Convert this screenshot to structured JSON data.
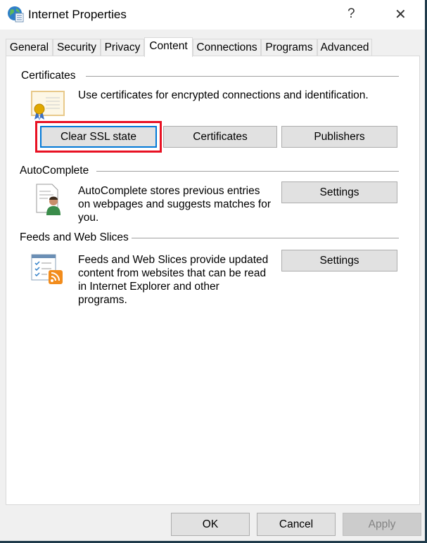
{
  "window": {
    "title": "Internet Properties",
    "help": "?",
    "close": "✕"
  },
  "tabs": [
    {
      "label": "General"
    },
    {
      "label": "Security"
    },
    {
      "label": "Privacy"
    },
    {
      "label": "Content",
      "selected": true
    },
    {
      "label": "Connections"
    },
    {
      "label": "Programs"
    },
    {
      "label": "Advanced"
    }
  ],
  "certificates": {
    "heading": "Certificates",
    "description": "Use certificates for encrypted connections and identification.",
    "buttons": {
      "clear_ssl": "Clear SSL state",
      "certificates": "Certificates",
      "publishers": "Publishers"
    },
    "highlight_color": "#e81123"
  },
  "autocomplete": {
    "heading": "AutoComplete",
    "lines": [
      "AutoComplete stores previous entries",
      "on webpages and suggests matches for",
      "you."
    ],
    "settings": "Settings"
  },
  "feeds": {
    "heading": "Feeds and Web Slices",
    "lines": [
      "Feeds and Web Slices provide updated",
      "content from websites that can be read",
      "in Internet Explorer and other",
      "programs."
    ],
    "settings": "Settings"
  },
  "footer": {
    "ok": "OK",
    "cancel": "Cancel",
    "apply": "Apply",
    "apply_disabled": true
  }
}
